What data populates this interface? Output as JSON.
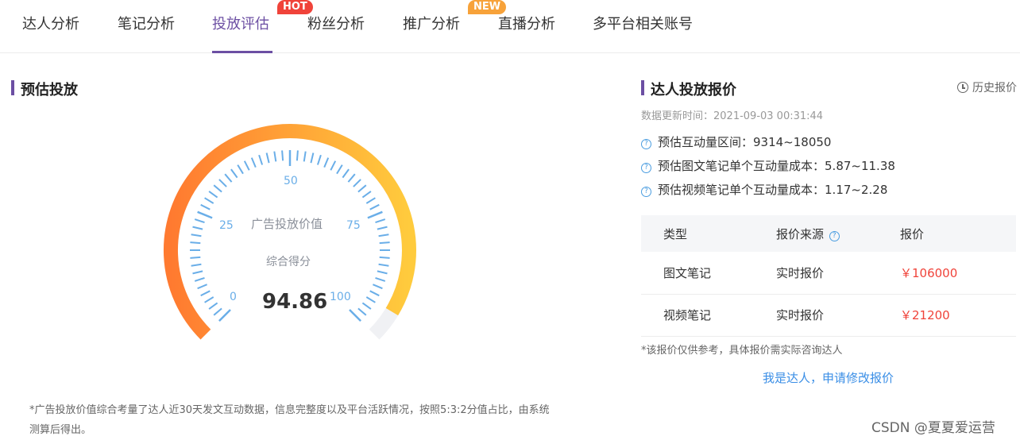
{
  "tabs": [
    {
      "label": "达人分析"
    },
    {
      "label": "笔记分析"
    },
    {
      "label": "投放评估",
      "active": true
    },
    {
      "label": "粉丝分析"
    },
    {
      "label": "推广分析"
    },
    {
      "label": "直播分析"
    },
    {
      "label": "多平台相关账号"
    }
  ],
  "badges": {
    "hot": "HOT",
    "new": "NEW"
  },
  "left": {
    "title": "预估投放",
    "gauge": {
      "label": "广告投放价值",
      "sub_label": "综合得分",
      "score": "94.86",
      "score_value": 94.86,
      "ticks": [
        "0",
        "25",
        "50",
        "75",
        "100"
      ]
    },
    "footnote": "*广告投放价值综合考量了达人近30天发文互动数据，信息完整度以及平台活跃情况，按照5:3:2分值占比，由系统测算后得出。"
  },
  "right": {
    "title": "达人投放报价",
    "history": "历史报价",
    "update_time": "数据更新时间：2021-09-03 00:31:44",
    "info": [
      "预估互动量区间：9314~18050",
      "预估图文笔记单个互动量成本：5.87~11.38",
      "预估视频笔记单个互动量成本：1.17~2.28"
    ],
    "table": {
      "headers": [
        "类型",
        "报价来源",
        "报价"
      ],
      "rows": [
        {
          "type": "图文笔记",
          "source": "实时报价",
          "price": "￥106000"
        },
        {
          "type": "视频笔记",
          "source": "实时报价",
          "price": "￥21200"
        }
      ]
    },
    "disclaimer": "*该报价仅供参考，具体报价需实际咨询达人",
    "apply_link": "我是达人，申请修改报价"
  },
  "watermark": "CSDN @夏夏爱运营",
  "colors": {
    "accent": "#6c4fa3",
    "price": "#f0433a",
    "link": "#3a8ee6",
    "gauge_start": "#ff7a30",
    "gauge_end": "#ffcb3d",
    "tick": "#6aaee8"
  }
}
